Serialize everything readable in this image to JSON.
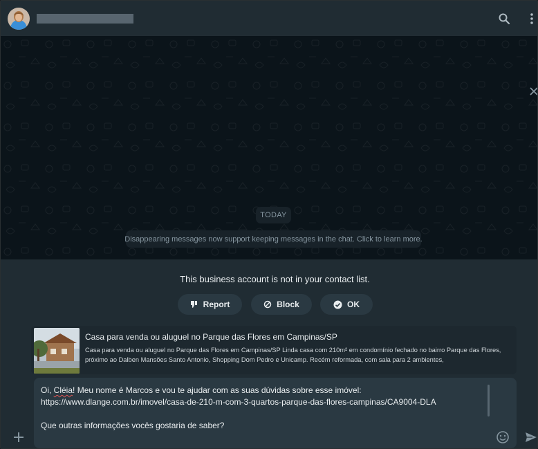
{
  "colors": {
    "header_bg": "#202c33",
    "chat_bg": "#0b141a",
    "panel_bg": "#202c33",
    "button_bg": "#2a3942",
    "text_primary": "#e9edef",
    "text_secondary": "#8696a0"
  },
  "header": {
    "avatar_icon": "contact-avatar",
    "contact_name_redacted": true,
    "icons": [
      "search-icon",
      "menu-icon"
    ]
  },
  "chat": {
    "date_label": "TODAY",
    "system_message": "Disappearing messages now support keeping messages in the chat. Click to learn more."
  },
  "business_notice": {
    "text": "This business account is not in your contact list.",
    "buttons": [
      {
        "label": "Report",
        "icon": "thumbs-down-icon"
      },
      {
        "label": "Block",
        "icon": "block-icon"
      },
      {
        "label": "OK",
        "icon": "check-circle-icon"
      }
    ]
  },
  "link_preview": {
    "title": "Casa para venda ou aluguel no Parque das Flores em Campinas/SP",
    "description": "Casa para venda ou aluguel no Parque das Flores em Campinas/SP Linda casa com 210m² em condomínio fechado no bairro Parque das Flores, próximo ao Dalben Mansões Santo Antonio, Shopping Dom Pedro e Unicamp. Recém reformada, com sala para 2 ambientes,"
  },
  "compose": {
    "line1_prefix": "Oi, ",
    "line1_name": "Cléia",
    "line1_rest": "! Meu nome é Marcos e vou te ajudar com as suas dúvidas sobre esse imóvel:",
    "line2": "https://www.dlange.com.br/imovel/casa-de-210-m-com-3-quartos-parque-das-flores-campinas/CA9004-DLA",
    "line3": "Que outras informações vocês gostaria de saber?"
  }
}
